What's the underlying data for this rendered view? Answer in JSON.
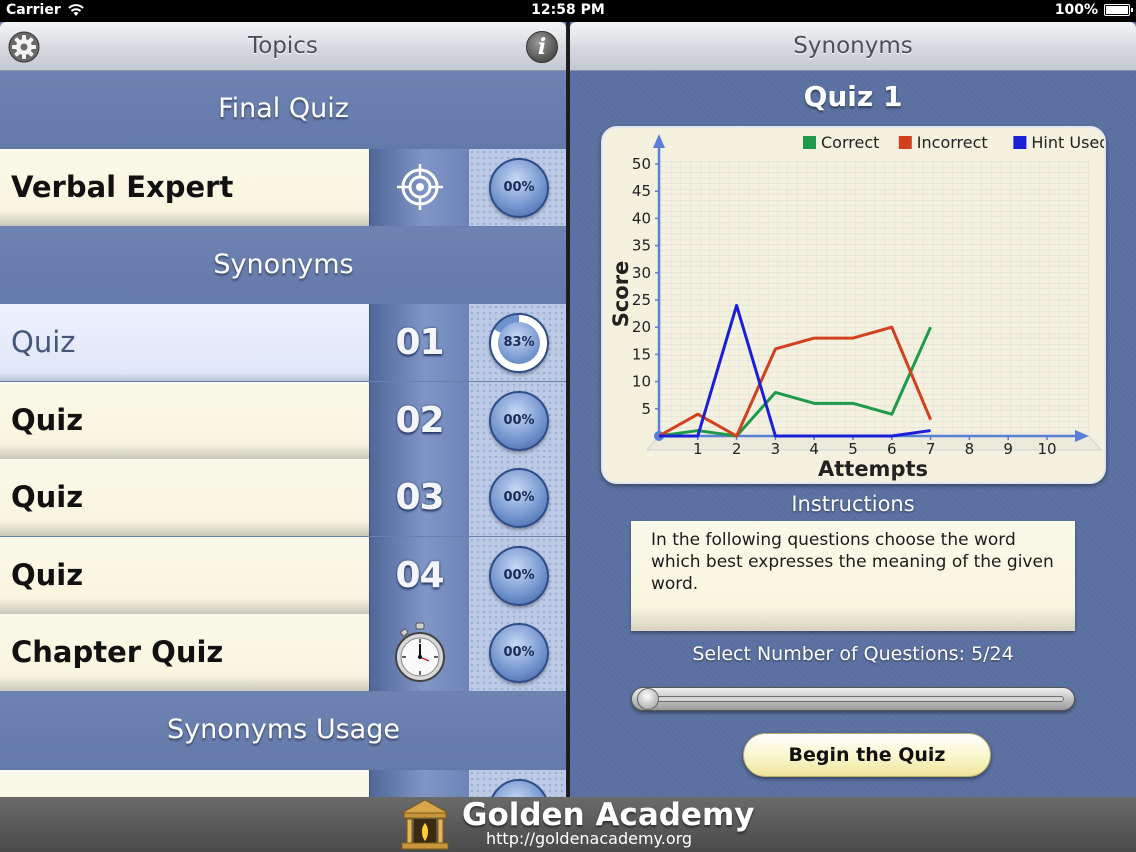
{
  "status_bar": {
    "carrier": "Carrier",
    "time": "12:58 PM",
    "battery": "100%"
  },
  "left_pane": {
    "title": "Topics",
    "settings_icon": "gear-icon",
    "info_icon": "info-icon",
    "info_glyph": "i",
    "sections": [
      {
        "header": "Final Quiz",
        "rows": [
          {
            "label": "Verbal Expert",
            "icon": "target-icon",
            "progress": "00%",
            "progress_value": 0
          }
        ]
      },
      {
        "header": "Synonyms",
        "rows": [
          {
            "label": "Quiz",
            "number": "01",
            "progress": "83%",
            "progress_value": 0.83,
            "selected": true
          },
          {
            "label": "Quiz",
            "number": "02",
            "progress": "00%",
            "progress_value": 0
          },
          {
            "label": "Quiz",
            "number": "03",
            "progress": "00%",
            "progress_value": 0
          },
          {
            "label": "Quiz",
            "number": "04",
            "progress": "00%",
            "progress_value": 0
          },
          {
            "label": "Chapter Quiz",
            "icon": "stopwatch-icon",
            "progress": "00%",
            "progress_value": 0
          }
        ]
      },
      {
        "header": "Synonyms Usage",
        "rows": []
      }
    ]
  },
  "right_pane": {
    "title": "Synonyms",
    "quiz_title": "Quiz 1",
    "instructions_title": "Instructions",
    "instructions_text": "In the following questions choose the word which best expresses the meaning of the given word.",
    "select_label": "Select Number of Questions: 5/24",
    "slider_value": 5,
    "slider_max": 24,
    "begin_button": "Begin the Quiz"
  },
  "chart_data": {
    "type": "line",
    "xlabel": "Attempts",
    "ylabel": "Score",
    "x": [
      0,
      1,
      2,
      3,
      4,
      5,
      6,
      7
    ],
    "xlim": [
      0,
      10
    ],
    "ylim": [
      0,
      50
    ],
    "x_ticks": [
      "1",
      "2",
      "3",
      "4",
      "5",
      "6",
      "7",
      "8",
      "9",
      "10"
    ],
    "y_ticks": [
      "5",
      "10",
      "15",
      "20",
      "25",
      "30",
      "35",
      "40",
      "45",
      "50"
    ],
    "grid": true,
    "legend_position": "top-right",
    "series": [
      {
        "name": "Correct",
        "color": "#1f9a4b",
        "values": [
          0,
          1,
          0,
          8,
          6,
          6,
          4,
          20
        ]
      },
      {
        "name": "Incorrect",
        "color": "#d2401e",
        "values": [
          0,
          4,
          0,
          16,
          18,
          18,
          20,
          3
        ]
      },
      {
        "name": "Hint Used",
        "color": "#1c1fd8",
        "values": [
          0,
          0,
          24,
          0,
          0,
          0,
          0,
          1
        ]
      }
    ]
  },
  "footer": {
    "brand": "Golden Academy",
    "url": "http://goldenacademy.org"
  }
}
